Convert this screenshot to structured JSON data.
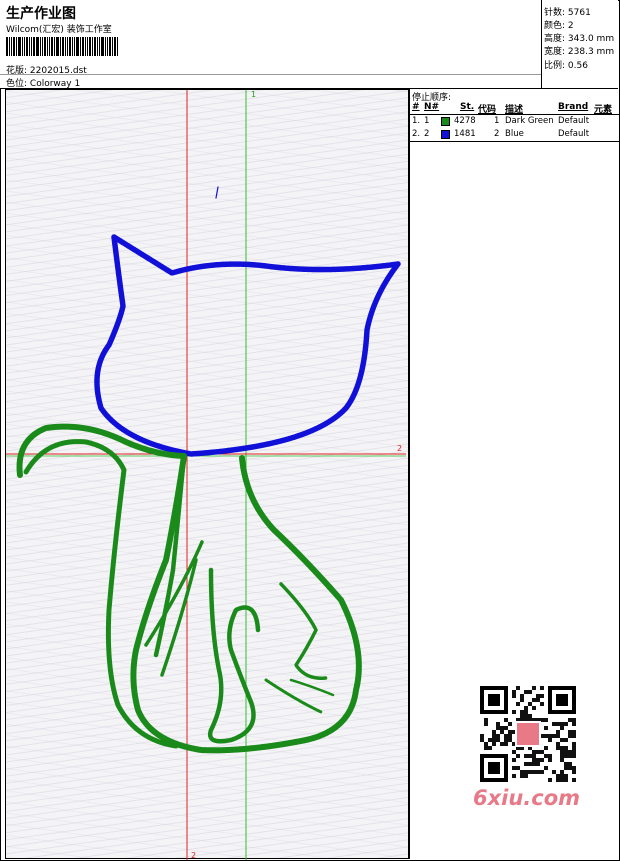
{
  "header": {
    "title": "生产作业图",
    "company": "Wilcom(汇宏) 装饰工作室",
    "design_label": "花版:",
    "design_value": "2202015.dst",
    "colorway_label": "色位:",
    "colorway_value": "Colorway 1"
  },
  "stats": [
    {
      "label": "针数:",
      "value": "5761"
    },
    {
      "label": "颜色:",
      "value": "2"
    },
    {
      "label": "高度:",
      "value": "343.0 mm"
    },
    {
      "label": "宽度:",
      "value": "238.3 mm"
    },
    {
      "label": "比例:",
      "value": "0.56"
    }
  ],
  "stop_table": {
    "title": "停止顺序:",
    "headers": [
      "#",
      "N#",
      "St.",
      "代码",
      "描述",
      "Brand",
      "元素"
    ],
    "rows": [
      {
        "idx": "1.",
        "n": "1",
        "color": "#1a8a1a",
        "stitches": "4278",
        "code": "1",
        "desc": "Dark Green",
        "brand": "Default"
      },
      {
        "idx": "2.",
        "n": "2",
        "color": "#1010d8",
        "stitches": "1481",
        "code": "2",
        "desc": "Blue",
        "brand": "Default"
      }
    ]
  },
  "guides": {
    "green_label": "1",
    "red_h_label": "2",
    "red_v_label": "2"
  },
  "colors": {
    "thread_green": "#1a8a1a",
    "thread_blue": "#1010d8",
    "guide_red": "#e02020",
    "guide_green": "#30c030"
  },
  "watermark": {
    "text": "6xiu.com",
    "qr_badge": "QR-code-icon"
  }
}
